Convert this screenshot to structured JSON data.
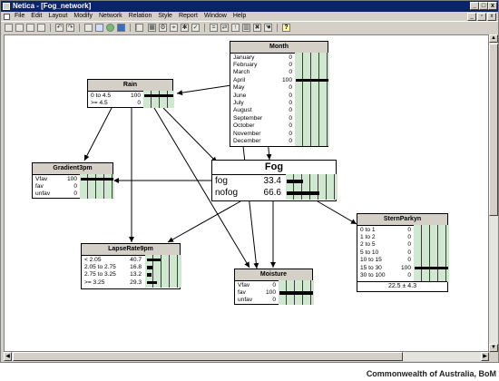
{
  "window": {
    "title": "Netica - [Fog_network]"
  },
  "menu": [
    "File",
    "Edit",
    "Layout",
    "Modify",
    "Network",
    "Relation",
    "Style",
    "Report",
    "Window",
    "Help"
  ],
  "toolbar": {
    "help_glyph": "?"
  },
  "nodes": {
    "month": {
      "title": "Month",
      "states": [
        {
          "label": "January",
          "value": "0",
          "prob": 0
        },
        {
          "label": "February",
          "value": "0",
          "prob": 0
        },
        {
          "label": "March",
          "value": "0",
          "prob": 0
        },
        {
          "label": "April",
          "value": "100",
          "prob": 100
        },
        {
          "label": "May",
          "value": "0",
          "prob": 0
        },
        {
          "label": "June",
          "value": "0",
          "prob": 0
        },
        {
          "label": "July",
          "value": "0",
          "prob": 0
        },
        {
          "label": "August",
          "value": "0",
          "prob": 0
        },
        {
          "label": "September",
          "value": "0",
          "prob": 0
        },
        {
          "label": "October",
          "value": "0",
          "prob": 0
        },
        {
          "label": "November",
          "value": "0",
          "prob": 0
        },
        {
          "label": "December",
          "value": "0",
          "prob": 0
        }
      ]
    },
    "rain": {
      "title": "Rain",
      "states": [
        {
          "label": "0 to 4.5",
          "value": "100",
          "prob": 100
        },
        {
          "label": ">= 4.5",
          "value": "0",
          "prob": 0
        }
      ]
    },
    "gradient": {
      "title": "Gradient3pm",
      "states": [
        {
          "label": "Vfav",
          "value": "100",
          "prob": 100
        },
        {
          "label": "fav",
          "value": "0",
          "prob": 0
        },
        {
          "label": "unfav",
          "value": "0",
          "prob": 0
        }
      ]
    },
    "fog": {
      "title": "Fog",
      "states": [
        {
          "label": "fog",
          "value": "33.4",
          "prob": 33.4
        },
        {
          "label": "nofog",
          "value": "66.6",
          "prob": 66.6
        }
      ]
    },
    "lapse": {
      "title": "LapseRate9pm",
      "states": [
        {
          "label": "< 2.05",
          "value": "40.7",
          "prob": 40.7
        },
        {
          "label": "2.05 to 2.75",
          "value": "16.8",
          "prob": 16.8
        },
        {
          "label": "2.75 to 3.25",
          "value": "13.2",
          "prob": 13.2
        },
        {
          "label": ">= 3.25",
          "value": "29.3",
          "prob": 29.3
        }
      ]
    },
    "moisture": {
      "title": "Moisture",
      "states": [
        {
          "label": "Vfav",
          "value": "0",
          "prob": 0
        },
        {
          "label": "fav",
          "value": "100",
          "prob": 100
        },
        {
          "label": "unfav",
          "value": "0",
          "prob": 0
        }
      ]
    },
    "stern": {
      "title": "SternParkyn",
      "states": [
        {
          "label": "0 to 1",
          "value": "0",
          "prob": 0
        },
        {
          "label": "1 to 2",
          "value": "0",
          "prob": 0
        },
        {
          "label": "2 to 5",
          "value": "0",
          "prob": 0
        },
        {
          "label": "5 to 10",
          "value": "0",
          "prob": 0
        },
        {
          "label": "10 to 15",
          "value": "0",
          "prob": 0
        },
        {
          "label": "15 to 30",
          "value": "100",
          "prob": 100
        },
        {
          "label": "30 to 100",
          "value": "0",
          "prob": 0
        }
      ],
      "footer": "22.5 ± 4.3"
    }
  },
  "credit": "Commonwealth of Australia, BoM"
}
